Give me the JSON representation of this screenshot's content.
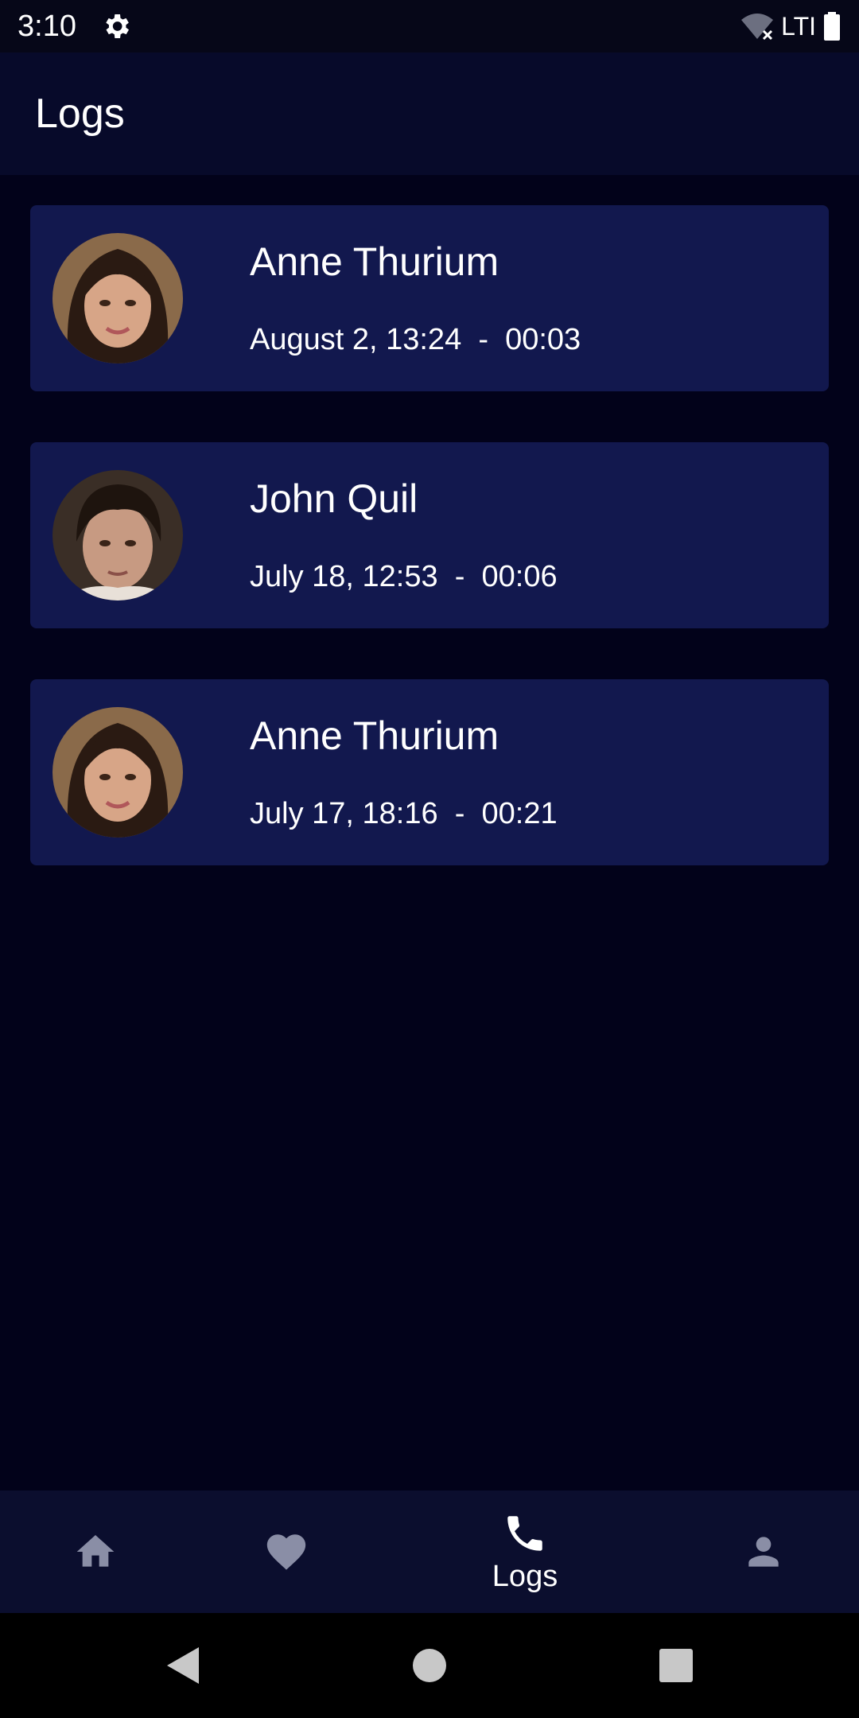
{
  "status_bar": {
    "time": "3:10",
    "network_label": "LTI",
    "icons": [
      "settings-gear-icon",
      "wifi-off-icon",
      "battery-icon"
    ]
  },
  "app_bar": {
    "title": "Logs"
  },
  "logs": [
    {
      "name": "Anne Thurium",
      "date": "August 2, 13:24",
      "duration": "00:03",
      "avatar": "female-avatar",
      "meta": "August 2, 13:24  -  00:03"
    },
    {
      "name": "John Quil",
      "date": "July 18, 12:53",
      "duration": "00:06",
      "avatar": "male-avatar",
      "meta": "July 18, 12:53  -  00:06"
    },
    {
      "name": "Anne Thurium",
      "date": "July 17, 18:16",
      "duration": "00:21",
      "avatar": "female-avatar",
      "meta": "July 17, 18:16  -  00:21"
    }
  ],
  "bottom_nav": {
    "items": [
      {
        "icon": "home-icon",
        "label": "",
        "active": false
      },
      {
        "icon": "heart-icon",
        "label": "",
        "active": false
      },
      {
        "icon": "phone-icon",
        "label": "Logs",
        "active": true
      },
      {
        "icon": "person-icon",
        "label": "",
        "active": false
      }
    ]
  },
  "colors": {
    "background": "#02021a",
    "card": "#12184e",
    "app_bar": "#070a2a",
    "nav_inactive": "#8a8ea6",
    "nav_active": "#ffffff"
  }
}
